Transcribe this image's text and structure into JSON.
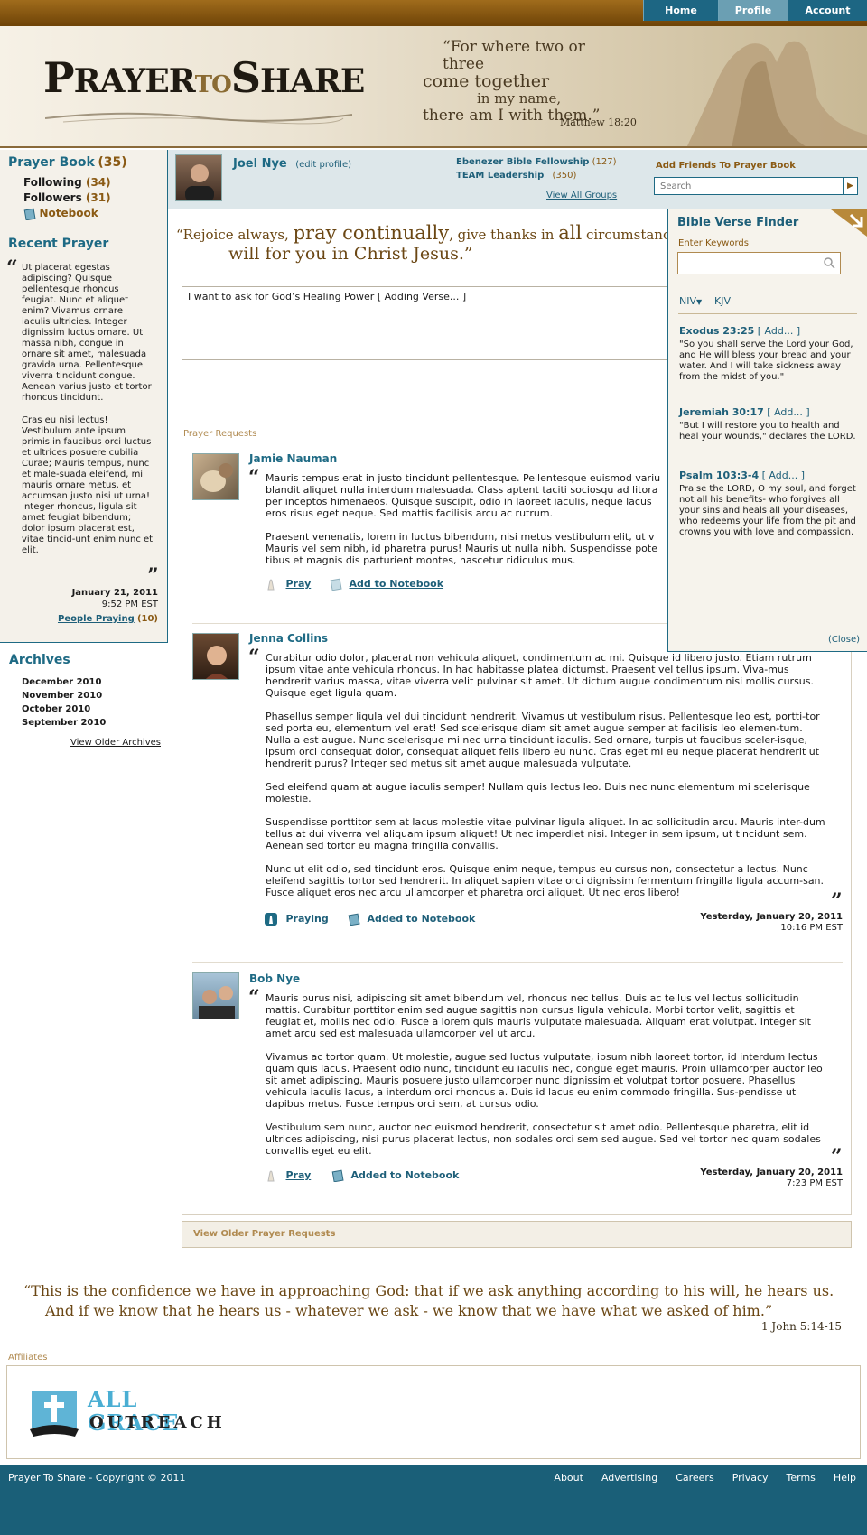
{
  "nav": {
    "items": [
      "Home",
      "Profile",
      "Account"
    ],
    "active": "Profile"
  },
  "header": {
    "logo_big1": "P",
    "logo_word1": "RAYER",
    "logo_to": "TO",
    "logo_big2": "S",
    "logo_word2": "HARE",
    "quote_line1": "“For where two or three",
    "quote_line2": "come together",
    "quote_line3": "in my name,",
    "quote_line4": "there am I with them.”",
    "quote_ref": "Matthew 18:20"
  },
  "sidebar": {
    "prayer_book_label": "Prayer Book",
    "prayer_book_count": "(35)",
    "following_label": "Following",
    "following_count": "(34)",
    "followers_label": "Followers",
    "followers_count": "(31)",
    "notebook_label": "Notebook",
    "recent_title": "Recent Prayer",
    "recent_p1": "Ut placerat egestas adipiscing? Quisque pellentesque rhoncus feugiat. Nunc et aliquet enim? Vivamus ornare iaculis ultricies. Integer dignissim luctus ornare. Ut massa nibh, congue in ornare sit amet, malesuada gravida urna. Pellentesque viverra tincidunt congue. Aenean varius justo et tortor rhoncus tincidunt.",
    "recent_p2": "Cras eu nisi lectus! Vestibulum ante ipsum primis in faucibus orci luctus et ultrices posuere cubilia Curae; Mauris tempus, nunc et male-suada eleifend, mi mauris ornare metus, et accumsan justo nisi ut urna! Integer rhoncus, ligula sit amet feugiat bibendum; dolor ipsum placerat est, vitae tincid-unt enim nunc et elit.",
    "recent_date": "January 21, 2011",
    "recent_time": "9:52 PM EST",
    "people_praying_label": "People Praying",
    "people_praying_count": "(10)",
    "archives_title": "Archives",
    "archives": [
      "December 2010",
      "November 2010",
      "October 2010",
      "September 2010"
    ],
    "older_archives": "View Older Archives"
  },
  "profile": {
    "name": "Joel Nye",
    "edit": "(edit profile)",
    "groups": [
      {
        "name": "Ebenezer Bible Fellowship",
        "count": "(127)"
      },
      {
        "name": "TEAM Leadership",
        "count": "(350)"
      }
    ],
    "view_groups": "View All Groups",
    "add_friends": "Add Friends To Prayer Book",
    "search_placeholder": "Search"
  },
  "main": {
    "verse_line1a": "“Rejoice always, ",
    "verse_line1b": "pray continually",
    "verse_line1c": ", give thanks in ",
    "verse_line1d": "all",
    "verse_line1e": " circumstances;",
    "verse_line2": "will for you in Christ Jesus.”",
    "compose_text": "I want to ask for God’s Healing Power [ Adding Verse... ]",
    "requests_label": "Prayer Requests",
    "view_older": "View Older Prayer Requests"
  },
  "posts": [
    {
      "name": "Jamie Nauman",
      "paragraphs": [
        "Mauris tempus erat in justo tincidunt pellentesque. Pellentesque euismod variu blandit aliquet nulla interdum malesuada. Class aptent taciti sociosqu ad litora per inceptos himenaeos. Quisque suscipit, odio in laoreet iaculis, neque lacus eros risus eget neque. Sed mattis facilisis arcu ac rutrum.",
        "Praesent venenatis, lorem in luctus bibendum, nisi metus vestibulum elit, ut v Mauris vel sem nibh, id pharetra purus! Mauris ut nulla nibh. Suspendisse pote tibus et magnis dis parturient montes, nascetur ridiculus mus."
      ],
      "pray": "Pray",
      "notebook": "Add to Notebook"
    },
    {
      "name": "Jenna Collins",
      "paragraphs": [
        "Curabitur odio dolor, placerat non vehicula aliquet, condimentum ac mi. Quisque id libero justo. Etiam rutrum ipsum vitae ante vehicula rhoncus. In hac habitasse platea dictumst. Praesent vel tellus ipsum. Viva-mus hendrerit varius massa, vitae viverra velit pulvinar sit amet. Ut dictum augue condimentum nisi mollis cursus. Quisque eget ligula quam.",
        "Phasellus semper ligula vel dui tincidunt hendrerit. Vivamus ut vestibulum risus. Pellentesque leo est, portti-tor sed porta eu, elementum vel erat! Sed scelerisque diam sit amet augue semper at facilisis leo elemen-tum. Nulla a est augue. Nunc scelerisque mi nec urna tincidunt iaculis. Sed ornare, turpis ut faucibus sceler-isque, ipsum orci consequat dolor, consequat aliquet felis libero eu nunc. Cras eget mi eu neque placerat hendrerit ut hendrerit purus? Integer sed metus sit amet augue malesuada vulputate.",
        "Sed eleifend quam at augue iaculis semper! Nullam quis lectus leo. Duis nec nunc elementum mi scelerisque molestie.",
        "Suspendisse porttitor sem at lacus molestie vitae pulvinar ligula aliquet. In ac sollicitudin arcu. Mauris inter-dum tellus at dui viverra vel aliquam ipsum aliquet! Ut nec imperdiet nisi. Integer in sem ipsum, ut tincidunt sem. Aenean sed tortor eu magna fringilla convallis.",
        "Nunc ut elit odio, sed tincidunt eros. Quisque enim neque, tempus eu cursus non, consectetur a lectus. Nunc eleifend sagittis tortor sed hendrerit. In aliquet sapien vitae orci dignissim fermentum fringilla ligula accum-san. Fusce aliquet eros nec arcu ullamcorper et pharetra orci aliquet. Ut nec eros libero!"
      ],
      "pray": "Praying",
      "notebook": "Added to Notebook",
      "date": "Yesterday, January 20, 2011",
      "time": "10:16 PM EST"
    },
    {
      "name": "Bob Nye",
      "paragraphs": [
        "Mauris purus nisi, adipiscing sit amet bibendum vel, rhoncus nec tellus. Duis ac tellus vel lectus sollicitudin mattis. Curabitur porttitor enim sed augue sagittis non cursus ligula vehicula. Morbi tortor velit, sagittis et feugiat et, mollis nec odio. Fusce a lorem quis mauris vulputate malesuada. Aliquam erat volutpat. Integer sit amet arcu sed est malesuada ullamcorper vel ut arcu.",
        "Vivamus ac tortor quam. Ut molestie, augue sed luctus vulputate, ipsum nibh laoreet tortor, id interdum lectus quam quis lacus. Praesent odio nunc, tincidunt eu iaculis nec, congue eget mauris. Proin ullamcorper auctor leo sit amet adipiscing. Mauris posuere justo ullamcorper nunc dignissim et volutpat tortor posuere. Phasellus vehicula iaculis lacus, a interdum orci rhoncus a. Duis id lacus eu enim commodo fringilla. Sus-pendisse ut dapibus metus. Fusce tempus orci sem, at cursus odio.",
        "Vestibulum sem nunc, auctor nec euismod hendrerit, consectetur sit amet odio. Pellentesque pharetra, elit id ultrices adipiscing, nisi purus placerat lectus, non sodales orci sem sed augue. Sed vel tortor nec quam sodales convallis eget eu elit."
      ],
      "pray": "Pray",
      "notebook": "Added to Notebook",
      "date": "Yesterday, January 20, 2011",
      "time": "7:23 PM EST"
    }
  ],
  "verse_finder": {
    "title": "Bible Verse Finder",
    "keywords_label": "Enter Keywords",
    "niv": "NIV",
    "kjv": "KJV",
    "add": "[ Add... ]",
    "verses": [
      {
        "ref": "Exodus 23:25",
        "text": "\"So you shall serve the Lord your God, and He will bless your bread and your water. And I will take sickness away from the midst of you.\""
      },
      {
        "ref": "Jeremiah 30:17",
        "text": "\"But I will restore you to health and heal your wounds,\" declares the LORD."
      },
      {
        "ref": "Psalm 103:3-4",
        "text": "Praise the LORD, O my soul, and forget not all his benefits- who forgives all your sins and heals all your diseases, who redeems your life from the pit and crowns you with love and compassion."
      }
    ],
    "close": "(Close)"
  },
  "bottom_quote": {
    "line1": "“This is the confidence we have in approaching God: that if we ask anything according to his will, he hears us.",
    "line2": "And if we know that he hears us - whatever we ask - we know that we have what we asked of him.”",
    "ref": "1 John 5:14-15"
  },
  "affiliates": {
    "label": "Affiliates",
    "logo_line1": "ALL GRACE",
    "logo_line2": "OUTREACH"
  },
  "footer": {
    "copyright": "Prayer To Share - Copyright © 2011",
    "links": [
      "About",
      "Advertising",
      "Careers",
      "Privacy",
      "Terms",
      "Help"
    ]
  },
  "colors": {
    "accent": "#1e6a84",
    "brown": "#8a5a14",
    "footer": "#1a5f78"
  }
}
